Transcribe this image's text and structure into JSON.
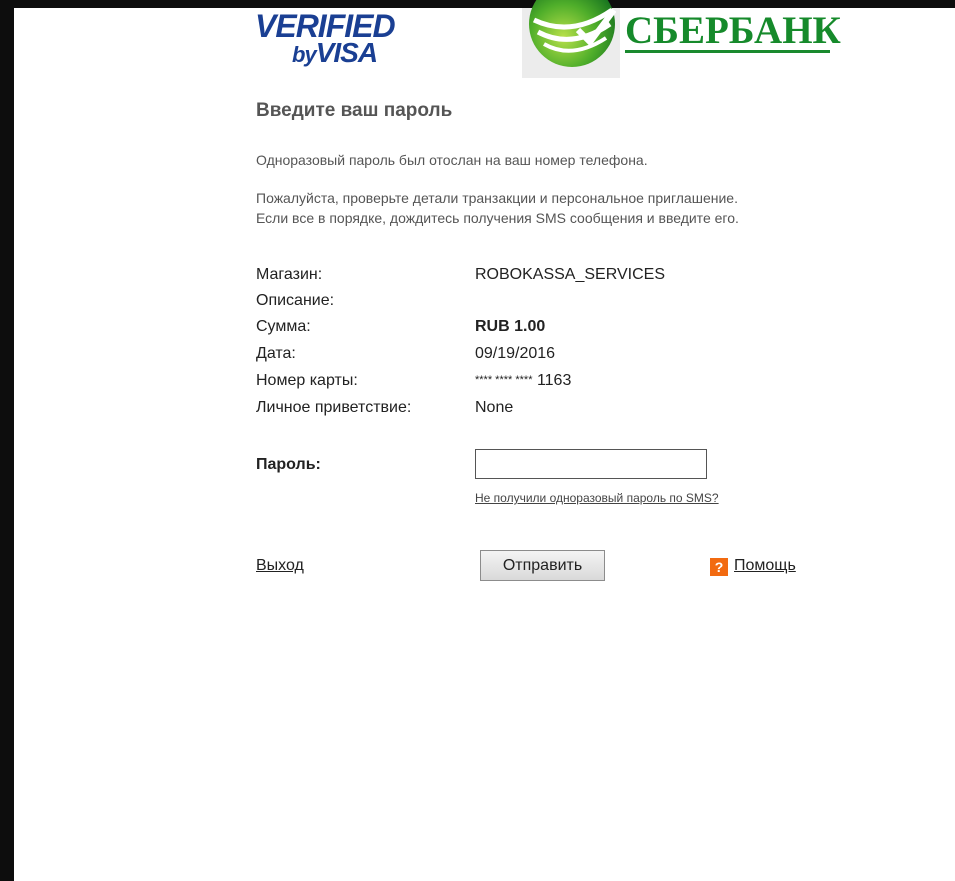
{
  "logos": {
    "visa_line1": "VERIFIED",
    "visa_by": "by",
    "visa_line2": "VISA",
    "bank_name": "СБЕРБАНК",
    "bank_color": "#168a2b",
    "visa_color": "#1a3f93"
  },
  "page": {
    "heading": "Введите ваш пароль",
    "otp_sent_text": "Одноразовый пароль был отослан на ваш номер телефона.",
    "instructions_line1": "Пожалуйста, проверьте детали транзакции и персональное приглашение.",
    "instructions_line2": "Если все в порядке, дождитесь получения SMS сообщения и введите его."
  },
  "details": {
    "merchant_label": "Магазин:",
    "merchant_value": "ROBOKASSA_SERVICES",
    "description_label": "Описание:",
    "description_value": "",
    "amount_label": "Сумма:",
    "amount_value": "RUB 1.00",
    "date_label": "Дата:",
    "date_value": "09/19/2016",
    "card_label": "Номер карты:",
    "card_mask": "**** **** ****",
    "card_last4": "1163",
    "greeting_label": "Личное приветствие:",
    "greeting_value": "None"
  },
  "form": {
    "password_label": "Пароль:",
    "password_value": "",
    "no_sms_link": "Не получили одноразовый пароль по SMS?",
    "exit_label": "Выход",
    "submit_label": "Отправить",
    "help_icon_glyph": "?",
    "help_label": "Помощь",
    "help_icon_color": "#f26a10"
  }
}
